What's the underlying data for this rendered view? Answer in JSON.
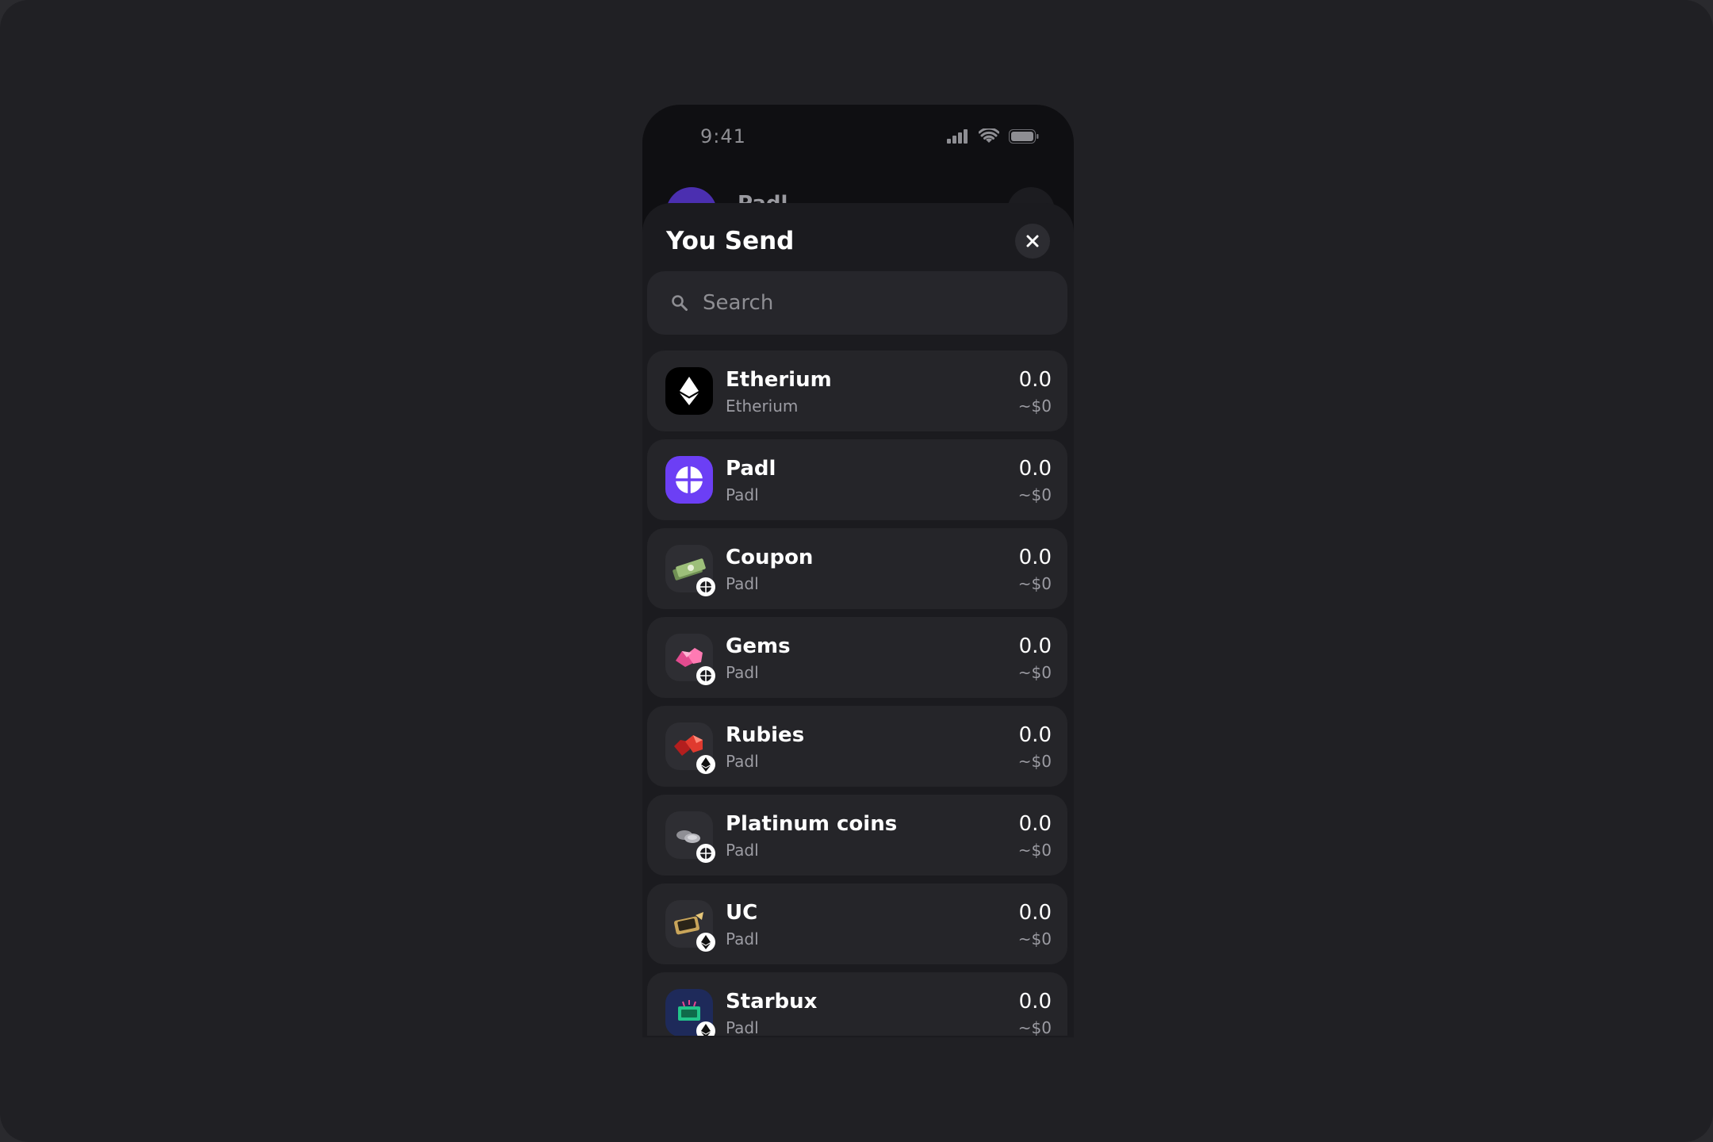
{
  "status_bar": {
    "time": "9:41"
  },
  "background_screen": {
    "label": "Padl"
  },
  "sheet": {
    "title": "You Send",
    "search": {
      "placeholder": "Search",
      "value": ""
    }
  },
  "tokens": [
    {
      "name": "Etherium",
      "network": "Etherium",
      "amount": "0.0",
      "usd": "~$0",
      "icon": "ethereum-icon",
      "badge": null
    },
    {
      "name": "Padl",
      "network": "Padl",
      "amount": "0.0",
      "usd": "~$0",
      "icon": "padl-icon",
      "badge": null
    },
    {
      "name": "Coupon",
      "network": "Padl",
      "amount": "0.0",
      "usd": "~$0",
      "icon": "cash-stack-icon",
      "badge": "padl-icon"
    },
    {
      "name": "Gems",
      "network": "Padl",
      "amount": "0.0",
      "usd": "~$0",
      "icon": "pink-gem-icon",
      "badge": "padl-icon"
    },
    {
      "name": "Rubies",
      "network": "Padl",
      "amount": "0.0",
      "usd": "~$0",
      "icon": "ruby-icon",
      "badge": "ethereum-icon"
    },
    {
      "name": "Platinum coins",
      "network": "Padl",
      "amount": "0.0",
      "usd": "~$0",
      "icon": "platinum-coins-icon",
      "badge": "padl-icon"
    },
    {
      "name": "UC",
      "network": "Padl",
      "amount": "0.0",
      "usd": "~$0",
      "icon": "uc-icon",
      "badge": "ethereum-icon"
    },
    {
      "name": "Starbux",
      "network": "Padl",
      "amount": "0.0",
      "usd": "~$0",
      "icon": "starbux-icon",
      "badge": "ethereum-icon"
    }
  ],
  "colors": {
    "background": "#202024",
    "sheet": "#1b1b1f",
    "row": "#252529",
    "padl_brand": "#6c3ff5",
    "text_primary": "#ffffff",
    "text_secondary": "#9c9ca3"
  }
}
